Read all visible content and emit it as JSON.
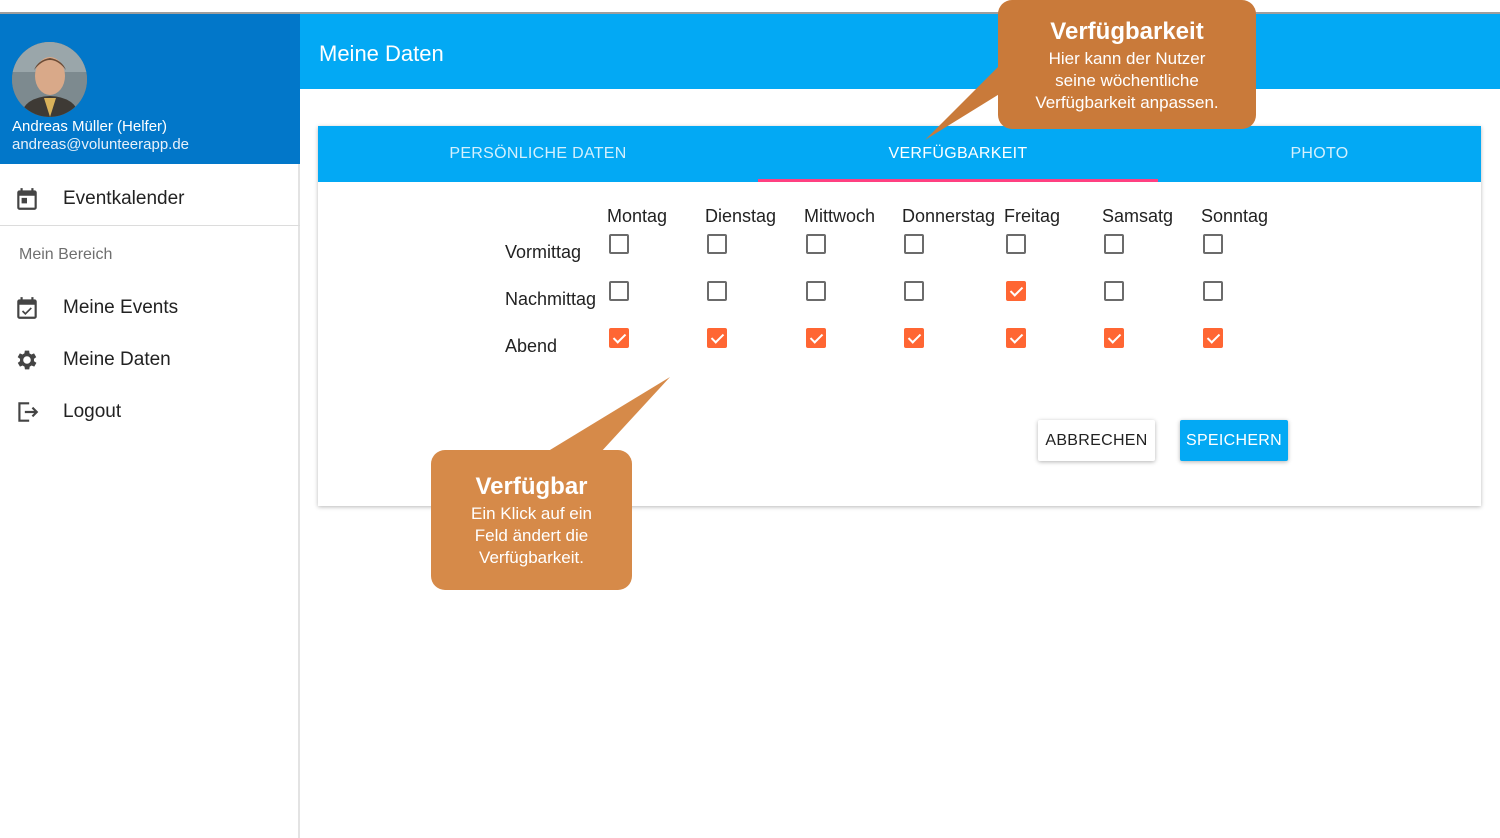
{
  "user": {
    "name": "Andreas Müller (Helfer)",
    "email": "andreas@volunteerapp.de"
  },
  "sidebar": {
    "top_item": "Eventkalender",
    "section_title": "Mein Bereich",
    "items": [
      "Meine Events",
      "Meine Daten",
      "Logout"
    ]
  },
  "header": {
    "title": "Meine Daten"
  },
  "tabs": [
    "PERSÖNLICHE DATEN",
    "VERFÜGBARKEIT",
    "PHOTO"
  ],
  "availability": {
    "days": [
      "Montag",
      "Dienstag",
      "Mittwoch",
      "Donnerstag",
      "Freitag",
      "Samsatg",
      "Sonntag"
    ],
    "rows": [
      {
        "label": "Vormittag",
        "values": [
          false,
          false,
          false,
          false,
          false,
          false,
          false
        ]
      },
      {
        "label": "Nachmittag",
        "values": [
          false,
          false,
          false,
          false,
          true,
          false,
          false
        ]
      },
      {
        "label": "Abend",
        "values": [
          true,
          true,
          true,
          true,
          true,
          true,
          true
        ]
      }
    ]
  },
  "buttons": {
    "cancel": "ABBRECHEN",
    "save": "SPEICHERN"
  },
  "callouts": {
    "tab": {
      "title": "Verfügbarkeit",
      "lines": [
        "Hier kann der Nutzer",
        "seine wöchentliche",
        "Verfügbarkeit anpassen."
      ]
    },
    "field": {
      "title": "Verfügbar",
      "lines": [
        "Ein Klick auf ein",
        "Feld ändert die",
        "Verfügbarkeit."
      ]
    }
  },
  "colors": {
    "primary": "#03a9f4",
    "profile_bg": "#0277c9",
    "checked": "#ff6633",
    "tab_ink": "#ff4081",
    "callout": "#d68a49"
  },
  "icons": {
    "eventkalender": "calendar-icon",
    "meine_events": "calendar-check-icon",
    "meine_daten": "gear-icon",
    "logout": "logout-icon"
  }
}
